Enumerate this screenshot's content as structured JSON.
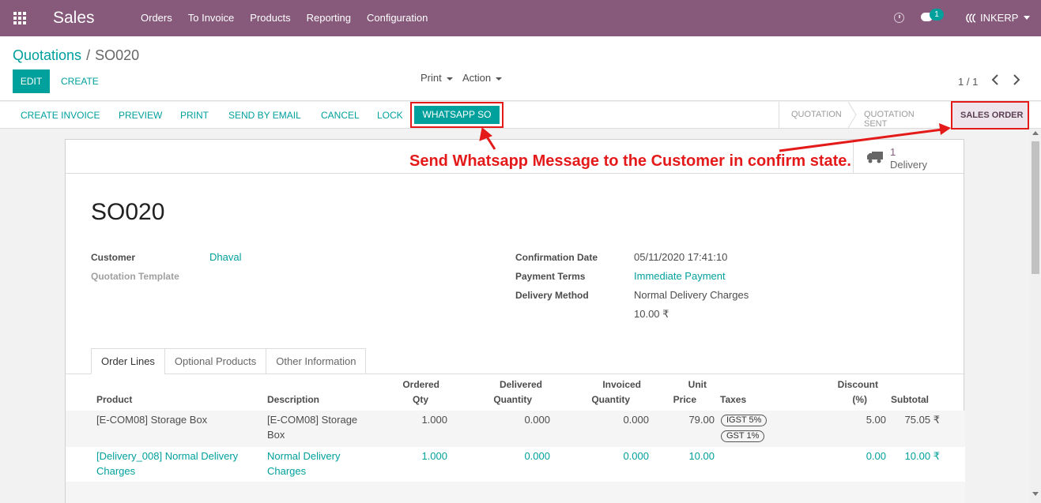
{
  "navbar": {
    "app_title": "Sales",
    "menu": [
      "Orders",
      "To Invoice",
      "Products",
      "Reporting",
      "Configuration"
    ],
    "chat_count": "1",
    "company": "INKERP"
  },
  "control": {
    "breadcrumb_parent": "Quotations",
    "breadcrumb_sep": "/",
    "breadcrumb_current": "SO020",
    "edit_label": "EDIT",
    "create_label": "CREATE",
    "print_label": "Print",
    "action_label": "Action",
    "pager": "1 / 1"
  },
  "statusbar": {
    "buttons": [
      "CREATE INVOICE",
      "PREVIEW",
      "PRINT",
      "SEND BY EMAIL",
      "CANCEL",
      "LOCK"
    ],
    "whatsapp_label": "WHATSAPP SO",
    "stages": [
      "QUOTATION",
      "QUOTATION SENT",
      "SALES ORDER"
    ]
  },
  "annotation": "Send Whatsapp Message to the Customer in confirm state.",
  "smart_button": {
    "count": "1",
    "label": "Delivery"
  },
  "order": {
    "name": "SO020",
    "customer_label": "Customer",
    "customer": "Dhaval",
    "template_label": "Quotation Template",
    "confirmation_date_label": "Confirmation Date",
    "confirmation_date": "05/11/2020 17:41:10",
    "payment_terms_label": "Payment Terms",
    "payment_terms": "Immediate Payment",
    "delivery_method_label": "Delivery Method",
    "delivery_method": "Normal Delivery Charges",
    "delivery_amount": "10.00 ₹"
  },
  "tabs": [
    "Order Lines",
    "Optional Products",
    "Other Information"
  ],
  "table": {
    "headers": {
      "product": "Product",
      "description": "Description",
      "ordered_1": "Ordered",
      "ordered_2": "Qty",
      "delivered_1": "Delivered",
      "delivered_2": "Quantity",
      "invoiced_1": "Invoiced",
      "invoiced_2": "Quantity",
      "unit_1": "Unit",
      "unit_2": "Price",
      "taxes": "Taxes",
      "discount_1": "Discount",
      "discount_2": "(%)",
      "subtotal": "Subtotal"
    },
    "rows": [
      {
        "product": "[E-COM08] Storage Box",
        "description_1": "[E-COM08] Storage",
        "description_2": "Box",
        "qty": "1.000",
        "delivered": "0.000",
        "invoiced": "0.000",
        "price": "79.00",
        "tax_1": "IGST 5%",
        "tax_2": "GST 1%",
        "discount": "5.00",
        "subtotal": "75.05 ₹"
      },
      {
        "product_1": "[Delivery_008] Normal Delivery",
        "product_2": "Charges",
        "description_1": "Normal Delivery",
        "description_2": "Charges",
        "qty": "1.000",
        "delivered": "0.000",
        "invoiced": "0.000",
        "price": "10.00",
        "discount": "0.00",
        "subtotal": "10.00 ₹"
      }
    ]
  }
}
